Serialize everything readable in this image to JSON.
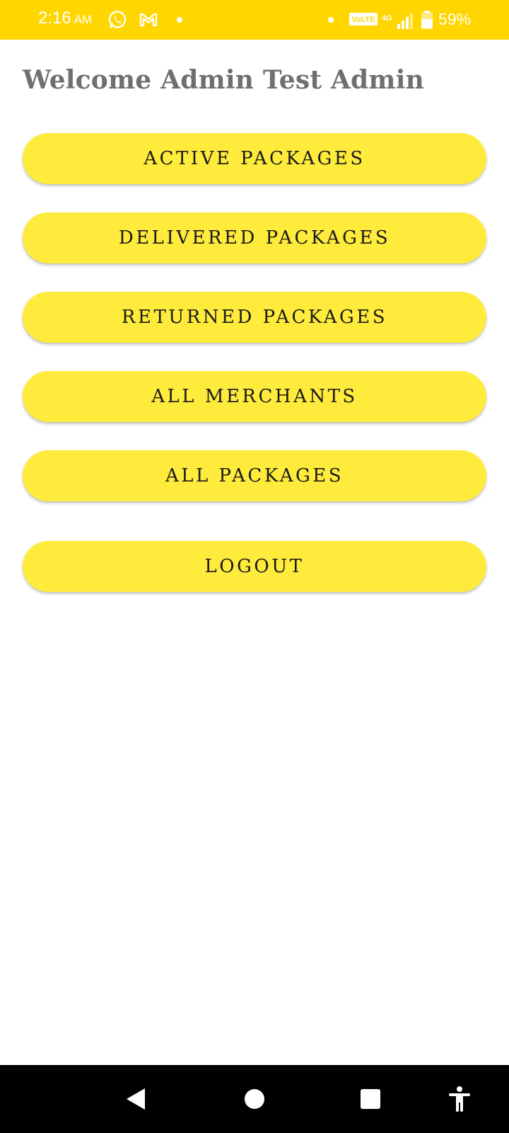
{
  "status_bar": {
    "time": "2:16",
    "ampm": "AM",
    "icons": [
      "whatsapp-icon",
      "gmail-icon",
      "notification-dot-icon",
      "dot-icon",
      "volte-icon",
      "signal-icon",
      "battery-icon"
    ],
    "volte": "VoLTE",
    "network": "4G",
    "battery": "59%",
    "color": "#FFD600"
  },
  "header": {
    "welcome": "Welcome Admin Test Admin"
  },
  "menu": {
    "active_packages": "ACTIVE PACKAGES",
    "delivered_packages": "DELIVERED PACKAGES",
    "returned_packages": "RETURNED PACKAGES",
    "all_merchants": "ALL MERCHANTS",
    "all_packages": "ALL PACKAGES",
    "logout": "LOGOUT",
    "button_color": "#FFEB3B"
  },
  "nav_bar": {
    "icons": [
      "back-icon",
      "home-icon",
      "recents-icon",
      "accessibility-icon"
    ]
  }
}
